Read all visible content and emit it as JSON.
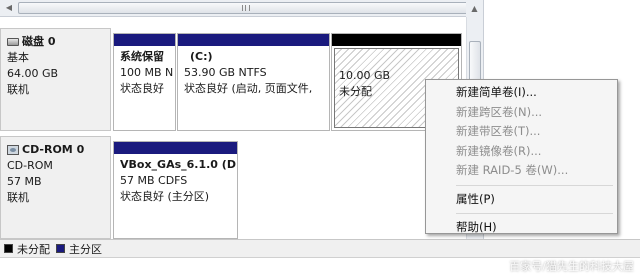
{
  "disks": [
    {
      "name": "磁盘 0",
      "lines": [
        "基本",
        "64.00 GB",
        "联机"
      ],
      "icon": "hard-disk-icon",
      "partitions": [
        {
          "title": "系统保留",
          "size": "100 MB N",
          "status": "状态良好"
        },
        {
          "title": "(C:)",
          "size": "53.90 GB NTFS",
          "status": "状态良好 (启动, 页面文件,"
        },
        {
          "title": "",
          "size": "10.00 GB",
          "status": "未分配"
        }
      ]
    },
    {
      "name": "CD-ROM 0",
      "lines": [
        "CD-ROM",
        "57 MB",
        "联机"
      ],
      "icon": "cd-rom-icon",
      "partitions": [
        {
          "title": "VBox_GAs_6.1.0  (D",
          "size": "57 MB CDFS",
          "status": "状态良好 (主分区)"
        }
      ]
    }
  ],
  "legend": [
    {
      "label": "未分配",
      "color": "#000000"
    },
    {
      "label": "主分区",
      "color": "#1a1a7e"
    }
  ],
  "context_menu": [
    {
      "label": "新建简单卷(I)...",
      "enabled": true
    },
    {
      "label": "新建跨区卷(N)...",
      "enabled": false
    },
    {
      "label": "新建带区卷(T)...",
      "enabled": false
    },
    {
      "label": "新建镜像卷(R)...",
      "enabled": false
    },
    {
      "label": "新建 RAID-5 卷(W)...",
      "enabled": false
    },
    {
      "label": "属性(P)",
      "enabled": true
    },
    {
      "label": "帮助(H)",
      "enabled": true
    }
  ],
  "watermark": "百家号/猫先生的科技大屋",
  "colors": {
    "primary_partition": "#1a1a7e",
    "unallocated": "#000000"
  }
}
